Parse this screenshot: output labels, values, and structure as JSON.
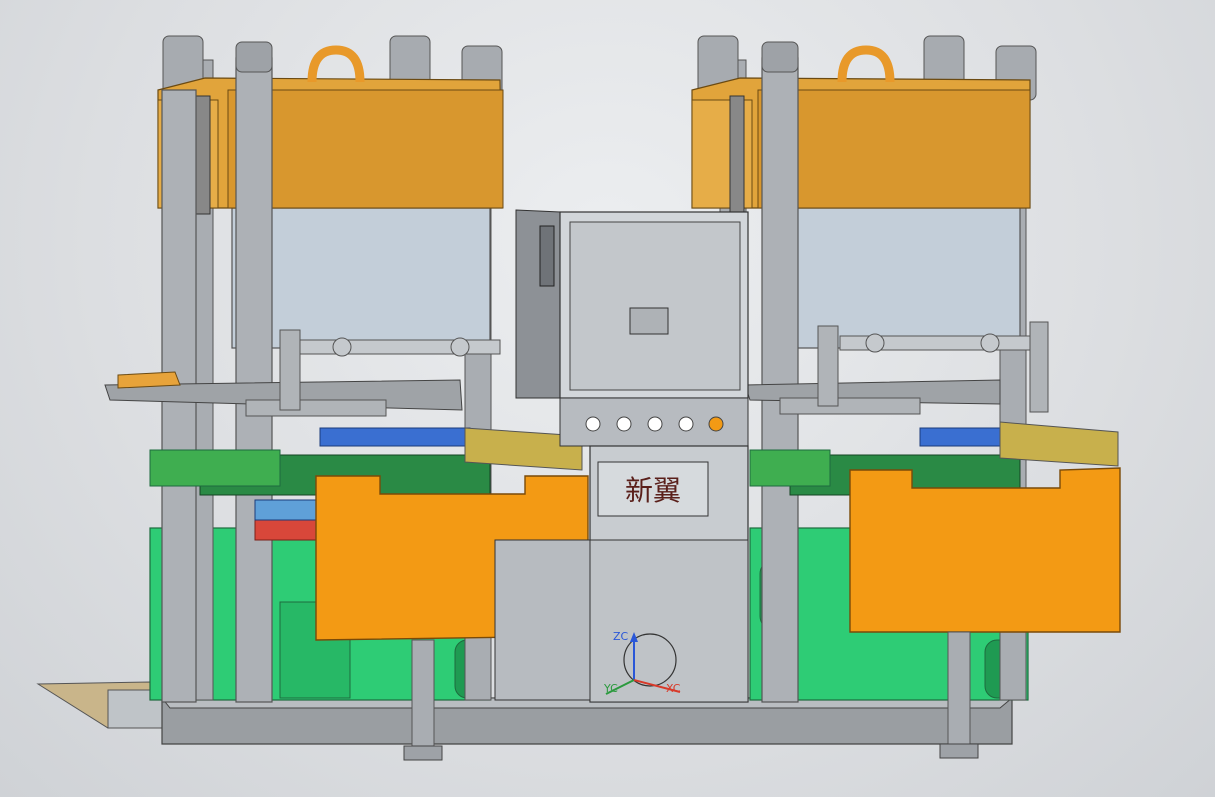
{
  "brand_plate": "新翼",
  "axes": {
    "z": "ZC",
    "y": "YC",
    "x": "XC"
  },
  "colors": {
    "background": "#dcdee1",
    "steel": "#b7bbc0",
    "column": "#a9adb2",
    "crosshead": "#e1a43b",
    "guard": "#f39a14",
    "green_frame": "#2ecc75",
    "dark_green": "#2a8a45",
    "blue_plate": "#3a6fd1",
    "red_plate": "#d8473a",
    "base": "#8f9397",
    "axis_z": "#2a57d8",
    "axis_y": "#2b9a3e",
    "axis_x": "#d83a2a"
  }
}
